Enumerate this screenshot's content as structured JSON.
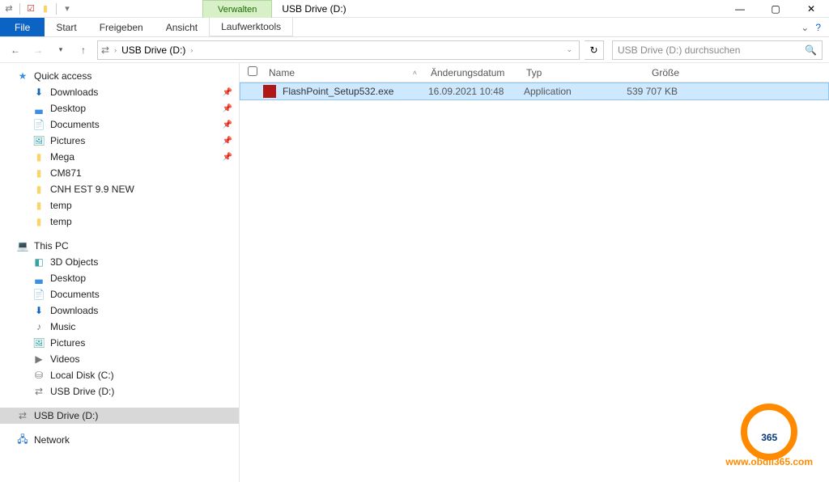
{
  "window": {
    "title": "USB Drive (D:)",
    "ribbon_context_tab": "Verwalten"
  },
  "ribbon": {
    "file": "File",
    "tabs": [
      "Start",
      "Freigeben",
      "Ansicht"
    ],
    "tools_tab": "Laufwerktools"
  },
  "nav": {
    "breadcrumb": "USB Drive (D:)",
    "search_placeholder": "USB Drive (D:) durchsuchen"
  },
  "sidebar": {
    "quick_access": "Quick access",
    "qa_items": [
      {
        "label": "Downloads",
        "pin": true,
        "icon": "⬇",
        "cls": "ic-darkblue"
      },
      {
        "label": "Desktop",
        "pin": true,
        "icon": "▃",
        "cls": "ic-blue"
      },
      {
        "label": "Documents",
        "pin": true,
        "icon": "📄",
        "cls": "ic-gray"
      },
      {
        "label": "Pictures",
        "pin": true,
        "icon": "🖼",
        "cls": "ic-teal"
      },
      {
        "label": "Mega",
        "pin": true,
        "icon": "▮",
        "cls": "ic-folder"
      },
      {
        "label": "CM871",
        "pin": false,
        "icon": "▮",
        "cls": "ic-folder"
      },
      {
        "label": "CNH EST 9.9 NEW",
        "pin": false,
        "icon": "▮",
        "cls": "ic-folder"
      },
      {
        "label": "temp",
        "pin": false,
        "icon": "▮",
        "cls": "ic-folder"
      },
      {
        "label": "temp",
        "pin": false,
        "icon": "▮",
        "cls": "ic-folder"
      }
    ],
    "this_pc": "This PC",
    "pc_items": [
      {
        "label": "3D Objects",
        "icon": "◧",
        "cls": "ic-teal"
      },
      {
        "label": "Desktop",
        "icon": "▃",
        "cls": "ic-blue"
      },
      {
        "label": "Documents",
        "icon": "📄",
        "cls": "ic-gray"
      },
      {
        "label": "Downloads",
        "icon": "⬇",
        "cls": "ic-darkblue"
      },
      {
        "label": "Music",
        "icon": "♪",
        "cls": "ic-gray"
      },
      {
        "label": "Pictures",
        "icon": "🖼",
        "cls": "ic-teal"
      },
      {
        "label": "Videos",
        "icon": "▶",
        "cls": "ic-gray"
      },
      {
        "label": "Local Disk (C:)",
        "icon": "⛁",
        "cls": "ic-gray"
      },
      {
        "label": "USB Drive (D:)",
        "icon": "⇄",
        "cls": "ic-gray"
      }
    ],
    "usb_root": "USB Drive (D:)",
    "network": "Network"
  },
  "columns": {
    "name": "Name",
    "date": "Änderungsdatum",
    "type": "Typ",
    "size": "Größe"
  },
  "files": [
    {
      "name": "FlashPoint_Setup532.exe",
      "date": "16.09.2021 10:48",
      "type": "Application",
      "size": "539 707 KB"
    }
  ],
  "watermark": {
    "text365": "365",
    "url": "www.obdii365.com"
  }
}
